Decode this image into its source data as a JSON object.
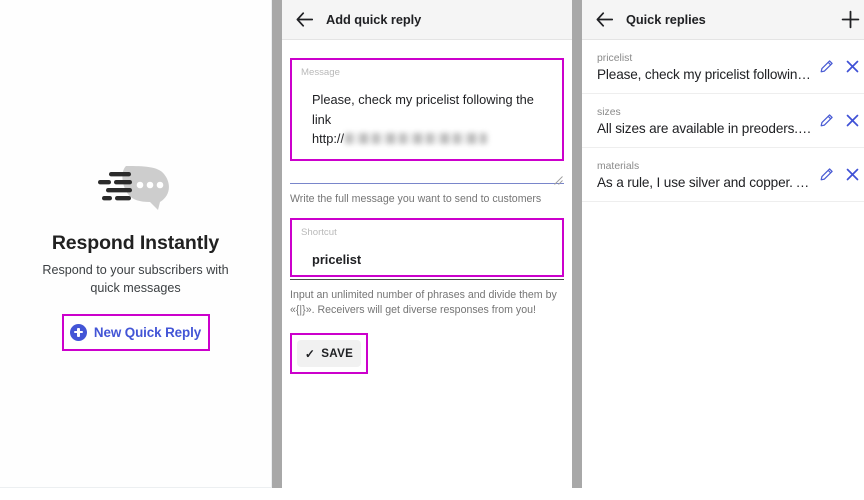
{
  "panels": {
    "left": {
      "name": "empty-state-panel",
      "icon": "fast-message-bubble-icon",
      "title": "Respond Instantly",
      "subtitle": "Respond to your subscribers with quick messages",
      "cta": {
        "label": "New Quick Reply",
        "icon": "plus-circle-icon",
        "color": "#4355d6",
        "highlight_color": "#cc00cc"
      }
    },
    "middle": {
      "name": "add-quick-reply-panel",
      "appbar": {
        "back_icon": "back-arrow-icon",
        "title": "Add quick reply"
      },
      "message_field": {
        "label": "Message",
        "value_line1": "Please, check my pricelist following the link",
        "value_line2_prefix": "http://",
        "value_line2_redacted": "[blurred url]",
        "highlighted": true
      },
      "message_helper": "Write the full message you want to send to customers",
      "shortcut_field": {
        "label": "Shortcut",
        "value": "pricelist",
        "highlighted": true
      },
      "shortcut_helper": "Input an unlimited number of phrases and divide them by «{|}». Receivers will get diverse responses from you!",
      "save_button": {
        "label": "SAVE",
        "icon": "check-icon",
        "highlighted": true
      }
    },
    "right": {
      "name": "quick-replies-panel",
      "appbar": {
        "back_icon": "back-arrow-icon",
        "title": "Quick replies",
        "add_icon": "plus-icon"
      },
      "rows": [
        {
          "shortcut": "pricelist",
          "message": "Please, check my pricelist following…",
          "edit_icon": "pencil-icon",
          "delete_icon": "close-icon"
        },
        {
          "shortcut": "sizes",
          "message": "All sizes are available in preoders. …",
          "edit_icon": "pencil-icon",
          "delete_icon": "close-icon"
        },
        {
          "shortcut": "materials",
          "message": "As a rule, I use silver and copper. A…",
          "edit_icon": "pencil-icon",
          "delete_icon": "close-icon"
        }
      ]
    }
  },
  "colors": {
    "accent_indigo": "#4355d6",
    "highlight_magenta": "#cc00cc",
    "appbar_bg": "#f5f5f5",
    "gutter": "#a8a8a8"
  }
}
